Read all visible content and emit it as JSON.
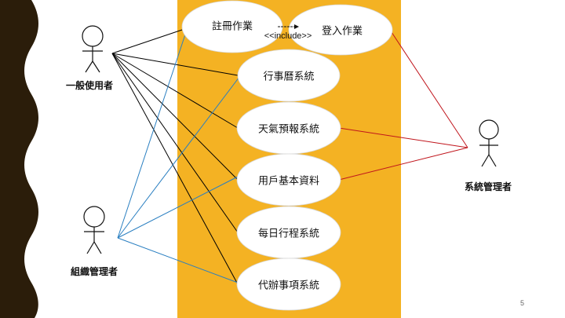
{
  "slide": {
    "page_number": "5",
    "colors": {
      "background": "#ffffff",
      "side_band": "#2b1d0a",
      "center_band": "#f4b223",
      "ellipse_fill": "#ffffff",
      "line_user": "#000000",
      "line_org_admin": "#2a7fc1",
      "line_sys_admin": "#c0151c"
    }
  },
  "actors": {
    "general_user": "一般使用者",
    "org_admin": "組織管理者",
    "sys_admin": "系統管理者"
  },
  "use_cases": {
    "register": "註冊作業",
    "login": "登入作業",
    "calendar": "行事曆系統",
    "weather": "天氣預報系統",
    "user_profile": "用戶基本資料",
    "daily_schedule": "每日行程系統",
    "todo": "代辦事項系統"
  },
  "relations": {
    "include_label": "<<include>>"
  }
}
